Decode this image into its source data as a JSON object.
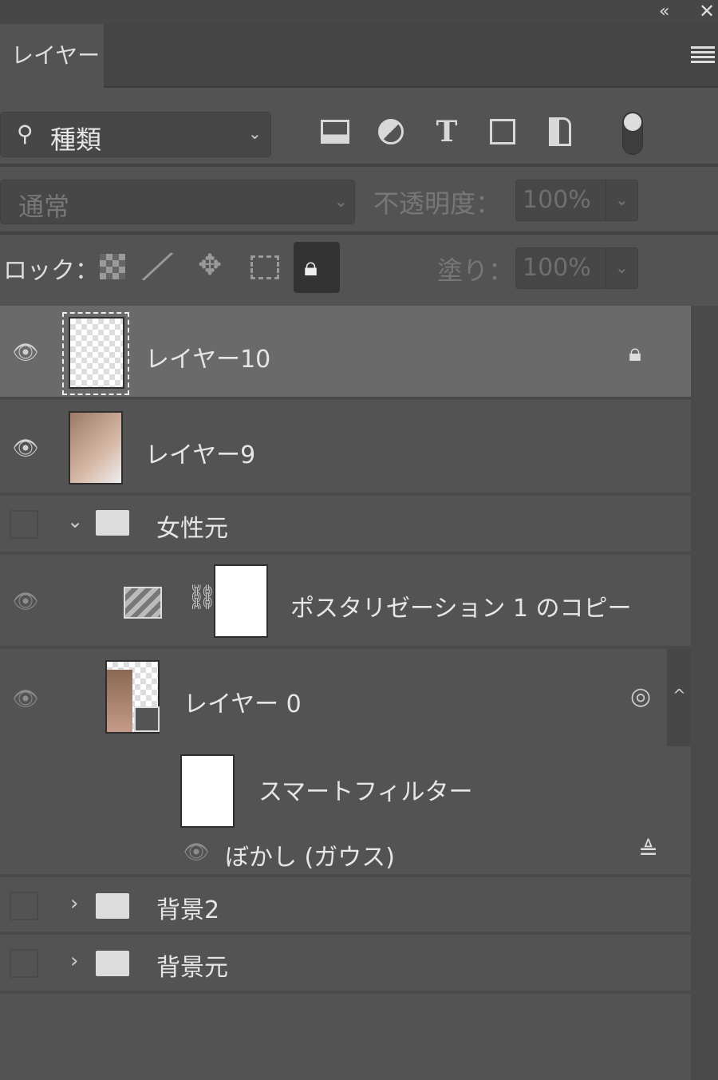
{
  "header": {
    "collapse_icon": "double-chevron-left-icon",
    "close_icon": "close-icon",
    "tab_label": "レイヤー",
    "menu_icon": "hamburger-menu-icon"
  },
  "filter": {
    "kind_label": "種類",
    "icons": [
      "image-filter-icon",
      "adjustment-filter-icon",
      "type-filter-icon",
      "shape-filter-icon",
      "smart-object-filter-icon"
    ],
    "toggle_on": true
  },
  "blend": {
    "mode": "通常",
    "opacity_label": "不透明度：",
    "opacity_value": "100%"
  },
  "lock": {
    "label": "ロック：",
    "fill_label": "塗り：",
    "fill_value": "100%"
  },
  "layers": [
    {
      "name": "レイヤー10",
      "visible": true,
      "selected": true,
      "locked": true
    },
    {
      "name": "レイヤー9",
      "visible": true
    },
    {
      "name": "女性元",
      "type": "group",
      "expanded": true,
      "visible": false
    },
    {
      "name": "ポスタリゼーション 1 のコピー",
      "type": "adjustment",
      "visible": true
    },
    {
      "name": "レイヤー 0",
      "type": "smart-object",
      "visible": true,
      "smart_filters_label": "スマートフィルター",
      "filter_name": "ぼかし (ガウス)"
    },
    {
      "name": "背景2",
      "type": "group",
      "expanded": false,
      "visible": false
    },
    {
      "name": "背景元",
      "type": "group",
      "expanded": false,
      "visible": false
    }
  ]
}
